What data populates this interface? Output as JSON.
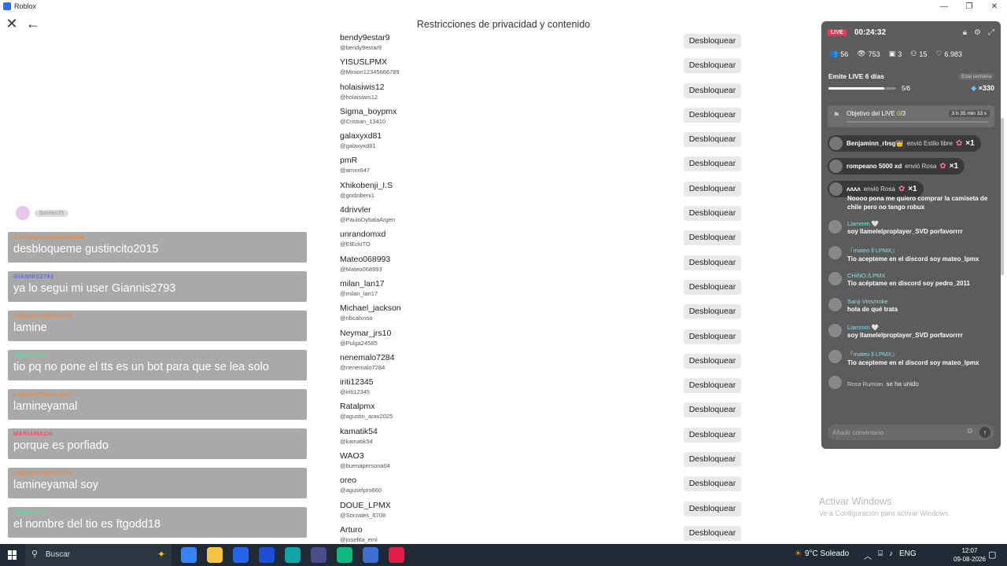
{
  "window": {
    "app_name": "Roblox",
    "minimize": "—",
    "maximize": "❐",
    "close": "✕"
  },
  "header": {
    "title": "Restricciones de privacidad y contenido",
    "close_glyph": "✕",
    "back_glyph": "←"
  },
  "blocked_users": [
    {
      "display": "bendy9estar9",
      "username": "@bendy9estar9"
    },
    {
      "display": "YISUSLPMX",
      "username": "@Minion12345666789"
    },
    {
      "display": "holaisiwis12",
      "username": "@holaisiwis12"
    },
    {
      "display": "Sigma_boypmx",
      "username": "@Cristian_13410"
    },
    {
      "display": "galaxyxd81",
      "username": "@galaxyxd81"
    },
    {
      "display": "pmR",
      "username": "@amxx647"
    },
    {
      "display": "Xhikobenji_I.S",
      "username": "@godzibeni1"
    },
    {
      "display": "4drivvler",
      "username": "@PauloDybalaArgen"
    },
    {
      "display": "unrandomxd",
      "username": "@ElEckiTO"
    },
    {
      "display": "Mateo068993",
      "username": "@Mateo068993"
    },
    {
      "display": "milan_lan17",
      "username": "@milan_lan17"
    },
    {
      "display": "Michael_jackson",
      "username": "@nbcalxnso"
    },
    {
      "display": "Neymar_jrs10",
      "username": "@Pulga24585"
    },
    {
      "display": "nenemalo7284",
      "username": "@nenemalo7284"
    },
    {
      "display": "iriti12345",
      "username": "@iriti12345"
    },
    {
      "display": "Ratalpmx",
      "username": "@agustin_arav2025"
    },
    {
      "display": "kamatik54",
      "username": "@kamatik54"
    },
    {
      "display": "WAO3",
      "username": "@buenapersona04"
    },
    {
      "display": "oreo",
      "username": "@aguselpro660"
    },
    {
      "display": "DOUE_LPMX",
      "username": "@Socrates_6708"
    },
    {
      "display": "Arturo",
      "username": "@josefita_emi"
    }
  ],
  "unblock_label": "Desbloquear",
  "chat_overlay": {
    "ghost_name": "Bastian25",
    "messages": [
      {
        "user": "AGUSTINBRUNAYAMAL",
        "text": "desbloqueme gustincito2015",
        "color": "#f08a3c"
      },
      {
        "user": "GIANNIS2793",
        "text": "ya lo segui mi user Giannis2793",
        "color": "#5f6cf0"
      },
      {
        "user": "LAMINEYAMALSOY",
        "text": "lamine",
        "color": "#f08a3c"
      },
      {
        "user": "TOYOTA520",
        "text": "tio pq no pone el tts es un bot para que se lea solo",
        "color": "#48e6a0"
      },
      {
        "user": "LAMINEYAMALSOY",
        "text": "lamineyamal",
        "color": "#f08a3c"
      },
      {
        "user": "MARIAMACH",
        "text": "porque es porfiado",
        "color": "#ff4d6d"
      },
      {
        "user": "LAMINEYAMALSOY",
        "text": "lamineyamal soy",
        "color": "#f08a3c"
      },
      {
        "user": "TOYOTA520",
        "text": "el nombre del tio es ftgodd18",
        "color": "#48e6a0"
      }
    ]
  },
  "live": {
    "badge": "LIVE",
    "timer": "00:24:32",
    "stats": [
      {
        "icon": "people-icon",
        "glyph": "👥",
        "value": "56"
      },
      {
        "icon": "eye-icon",
        "glyph": "👁",
        "value": "753"
      },
      {
        "icon": "gift-box-icon",
        "glyph": "▣",
        "value": "3"
      },
      {
        "icon": "person-plus-icon",
        "glyph": "⚇",
        "value": "15"
      },
      {
        "icon": "heart-icon",
        "glyph": "♡",
        "value": "6.983"
      }
    ],
    "streak_title": "Emite LIVE 6 días",
    "week_tag": "Esta semana",
    "progress_text": "5/6",
    "progress_fraction": 0.83,
    "reward": "×330",
    "goal_prefix": "Objetivo del LIVE",
    "goal_current": "0",
    "goal_total": "/3",
    "goal_time": "3 h 35 min 33 s",
    "gifts": [
      {
        "sender": "Benjaminn_rbsg👑",
        "action": "envió Estilo libre",
        "count": "×1"
      },
      {
        "sender": "rompeano 5000 xd",
        "action": "envió Rosa",
        "count": "×1"
      },
      {
        "sender": "ʌʌʌʌ",
        "action": "envió Rosa",
        "count": "×1"
      }
    ],
    "comments_partial": "Noooo pona me quiero comprar la camiseta de chile pero no tengo robux",
    "comments": [
      {
        "name": "Liammm 🤍",
        "text": "soy llamelelproplayer_SVD porfavorrrr"
      },
      {
        "name": "『mateo ll LPMX』",
        "text": "Tio acepteme en el discord soy mateo_lpmx"
      },
      {
        "name": "CHiNO:/LPMX",
        "text": "Tio acéptame en discord soy pedro_2011"
      },
      {
        "name": "Sanji Vinsmoke",
        "text": "hola de qué trata"
      },
      {
        "name": "Liammm 🤍",
        "text": "soy llamelelproplayer_SVD porfavorrrr"
      },
      {
        "name": "『mateo ll LPMX』",
        "text": "Tio acepteme en el discord soy mateo_lpmx"
      }
    ],
    "joined_name": "Rosa Rumian",
    "joined_text": "se ha unido",
    "input_placeholder": "Añadir comentario"
  },
  "watermark": {
    "line1": "Activar Windows",
    "line2": "Ve a Configuración para activar Windows."
  },
  "taskbar": {
    "search_label": "Buscar",
    "weather": "9°C Soleado",
    "language": "ENG",
    "time": "12:07",
    "date": "09-08-2026"
  }
}
